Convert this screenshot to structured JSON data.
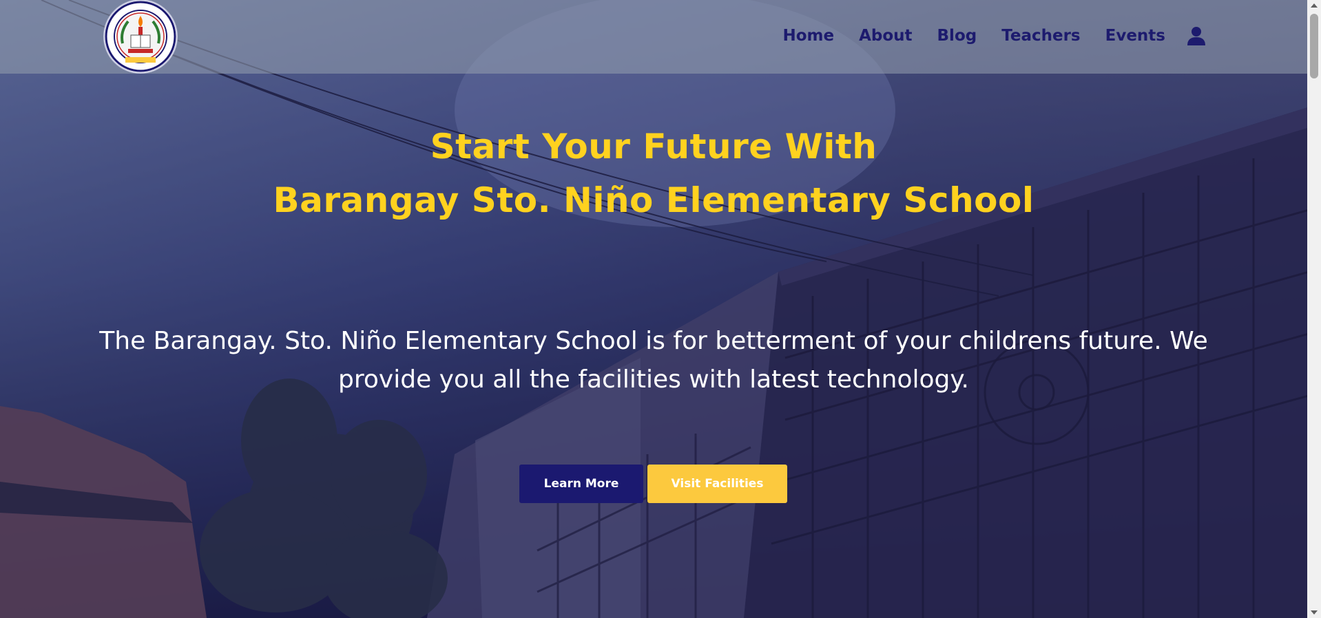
{
  "header": {
    "logo_icon": "school-seal-logo",
    "logo_text": "STO. NIÑO ELEMENTARY SCHOOL · SAN PEDRO LAGUNA · 1964",
    "nav": {
      "home": "Home",
      "about": "About",
      "blog": "Blog",
      "teachers": "Teachers",
      "events": "Events"
    },
    "user_icon": "user-icon"
  },
  "hero": {
    "title_line1": "Start Your Future With",
    "title_line2": "Barangay Sto. Niño Elementary School",
    "description": "The Barangay. Sto. Niño Elementary School is for betterment of your childrens future. We provide you all the facilities with latest technology.",
    "learn_more": "Learn More",
    "visit_facilities": "Visit Facilities"
  },
  "colors": {
    "title_yellow": "#ffd21f",
    "nav_navy": "#1d1b6e",
    "learn_button": "#1b1970",
    "visit_button": "#fcc93e"
  }
}
